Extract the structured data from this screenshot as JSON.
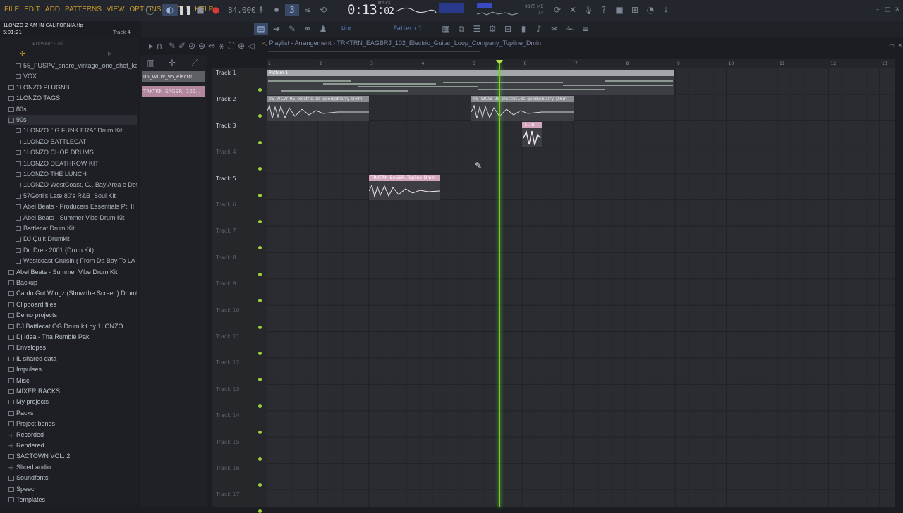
{
  "menu": [
    "FILE",
    "EDIT",
    "ADD",
    "PATTERNS",
    "VIEW",
    "OPTIONS",
    "TOOLS",
    "HELP"
  ],
  "transport": {
    "tempo": "84.000",
    "time_main": "0:13:",
    "time_frac": "02",
    "time_unit": "M:S:CS",
    "memory_line1": "9875 MB",
    "memory_line2": "14"
  },
  "info": {
    "file": "1LONZO 2 AM IN CALIFORNIA.flp",
    "time": "5:01:21",
    "track_hint": "Track 4"
  },
  "toolbar": {
    "pattern_label": "Pattern 1",
    "line_label": "Line"
  },
  "browser": {
    "header": "Browser - All",
    "items": [
      {
        "label": "55_FUSPV_snare_vintage_one_shot_kasio",
        "level": 1,
        "icon": "file-icon"
      },
      {
        "label": "VOX",
        "level": 1,
        "icon": "folder-icon"
      },
      {
        "label": "1LONZO PLUGNB",
        "level": 0,
        "icon": "folder-icon"
      },
      {
        "label": "1LONZO TAGS",
        "level": 0,
        "icon": "folder-icon"
      },
      {
        "label": "80s",
        "level": 0,
        "icon": "folder-icon"
      },
      {
        "label": "90s",
        "level": 0,
        "icon": "folder-open-icon"
      },
      {
        "label": "1LONZO '' G FUNK ERA'' Drum Kit",
        "level": 1,
        "icon": "folder-icon"
      },
      {
        "label": "1LONZO BATTLECAT",
        "level": 1,
        "icon": "folder-icon"
      },
      {
        "label": "1LONZO CHOP DRUMS",
        "level": 1,
        "icon": "folder-icon"
      },
      {
        "label": "1LONZO DEATHROW KIT",
        "level": 1,
        "icon": "folder-icon"
      },
      {
        "label": "1LONZO THE LUNCH",
        "level": 1,
        "icon": "folder-icon"
      },
      {
        "label": "1LONZO WestCoast, G., Bay Area e Detroit",
        "level": 1,
        "icon": "folder-icon"
      },
      {
        "label": "57Gotti's Late 80's R&B_Soul Kit",
        "level": 1,
        "icon": "folder-icon"
      },
      {
        "label": "Abel Beats - Producers Essentials Pt. II",
        "level": 1,
        "icon": "folder-icon"
      },
      {
        "label": "Abel Beats - Summer Vibe Drum Kit",
        "level": 1,
        "icon": "folder-icon"
      },
      {
        "label": "Battlecat Drum Kit",
        "level": 1,
        "icon": "folder-icon"
      },
      {
        "label": "DJ Quik Drumkit",
        "level": 1,
        "icon": "folder-icon"
      },
      {
        "label": "Dr. Dre - 2001 (Drum Kit)",
        "level": 1,
        "icon": "folder-icon"
      },
      {
        "label": "Westcoast Cruisin ( From Da Bay To LA )",
        "level": 1,
        "icon": "folder-icon"
      },
      {
        "label": "Abel Beats - Summer Vibe Drum Kit",
        "level": 0,
        "icon": "folder-icon"
      },
      {
        "label": "Backup",
        "level": 0,
        "icon": "folder-icon"
      },
      {
        "label": "Cardo Got Wingz (Show.the Screen) Drumkit",
        "level": 0,
        "icon": "folder-icon"
      },
      {
        "label": "Clipboard files",
        "level": 0,
        "icon": "folder-icon"
      },
      {
        "label": "Demo projects",
        "level": 0,
        "icon": "folder-icon"
      },
      {
        "label": "DJ Battlecat OG Drum kit by 1LONZO",
        "level": 0,
        "icon": "folder-icon"
      },
      {
        "label": "Dj Idea - Tha Rumble Pak",
        "level": 0,
        "icon": "folder-icon"
      },
      {
        "label": "Envelopes",
        "level": 0,
        "icon": "folder-icon"
      },
      {
        "label": "IL shared data",
        "level": 0,
        "icon": "folder-icon"
      },
      {
        "label": "Impulses",
        "level": 0,
        "icon": "folder-icon"
      },
      {
        "label": "Misc",
        "level": 0,
        "icon": "folder-icon"
      },
      {
        "label": "MIXER RACKS",
        "level": 0,
        "icon": "folder-icon"
      },
      {
        "label": "My projects",
        "level": 0,
        "icon": "folder-icon"
      },
      {
        "label": "Packs",
        "level": 0,
        "icon": "folder-icon"
      },
      {
        "label": "Project bones",
        "level": 0,
        "icon": "folder-icon"
      },
      {
        "label": "Recorded",
        "level": 0,
        "icon": "plus-icon"
      },
      {
        "label": "Rendered",
        "level": 0,
        "icon": "plus-icon"
      },
      {
        "label": "SACTOWN VOL. 2",
        "level": 0,
        "icon": "folder-icon"
      },
      {
        "label": "Sliced audio",
        "level": 0,
        "icon": "plus-icon"
      },
      {
        "label": "Soundfonts",
        "level": 0,
        "icon": "folder-icon"
      },
      {
        "label": "Speech",
        "level": 0,
        "icon": "folder-icon"
      },
      {
        "label": "Templates",
        "level": 0,
        "icon": "folder-icon"
      }
    ]
  },
  "picker": [
    "05_WCW_95_electri...",
    "TRKTRN_EAGBRJ_102..."
  ],
  "playlist": {
    "title": "Playlist - Arrangement",
    "breadcrumb": "TRKTRN_EAGBRJ_102_Electric_Guitar_Loop_Company_Topline_Dmin",
    "ruler": [
      "1",
      "2",
      "3",
      "4",
      "5",
      "6",
      "7",
      "8",
      "9",
      "10",
      "11",
      "12",
      "13"
    ],
    "tracks": [
      "Track 1",
      "Track 2",
      "Track 3",
      "Track 4",
      "Track 5",
      "Track 6",
      "Track 7",
      "Track 8",
      "Track 9",
      "Track 10",
      "Track 11",
      "Track 12",
      "Track 13",
      "Track 14",
      "Track 15",
      "Track 16",
      "Track 17"
    ],
    "clips": [
      {
        "label": "Pattern 1",
        "kind": "pattern"
      },
      {
        "label": "05_WCW_95_electric..ds_goodjoblarry_D#m",
        "kind": "audio"
      },
      {
        "label": "05_WCW_95_electric..ds_goodjoblarry_D#m",
        "kind": "audio"
      },
      {
        "label": "T...m",
        "kind": "pink"
      },
      {
        "label": "TRKTRN_EAGBR..Topline_Dmin",
        "kind": "pink"
      }
    ]
  },
  "colors": {
    "accent": "#c79a2e",
    "playhead": "#6bd62a",
    "dot": "#9ed13b",
    "blue": "#5d80c6"
  }
}
